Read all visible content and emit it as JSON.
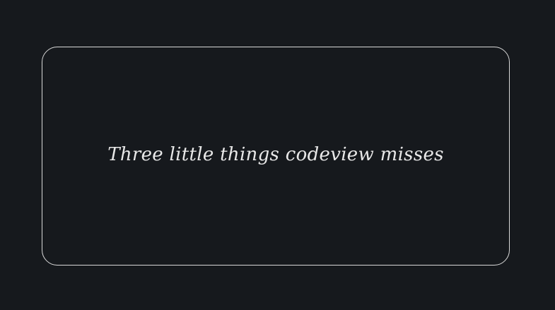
{
  "card": {
    "title": "Three little things codeview misses"
  },
  "colors": {
    "background": "#16191d",
    "border": "#d9d9d9",
    "text": "#e8e8e8"
  }
}
